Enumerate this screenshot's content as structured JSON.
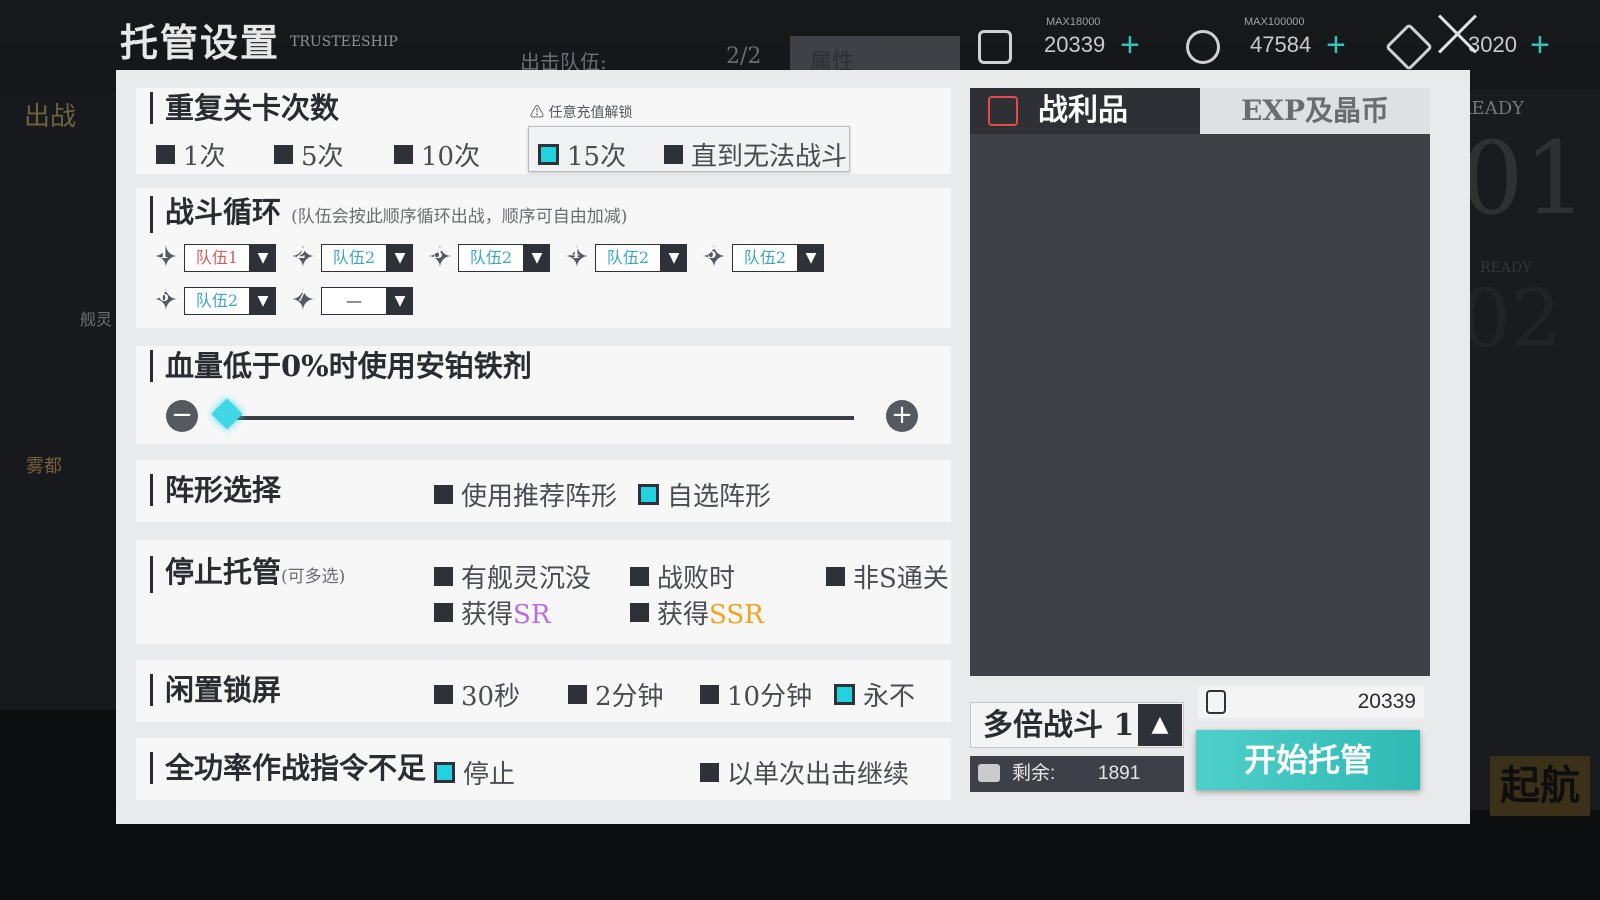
{
  "topbar": {
    "title": "托管设置",
    "subtitle": "TRUSTEESHIP",
    "fleet_label": "出击队伍:",
    "fleet_count": "2/2",
    "attribute_label": "属性",
    "resources": [
      {
        "icon": "oil-icon",
        "max": "MAX18000",
        "value": "20339"
      },
      {
        "icon": "coin-icon",
        "max": "MAX100000",
        "value": "47584"
      },
      {
        "icon": "gem-icon",
        "max": "",
        "value": "3020"
      }
    ]
  },
  "background": {
    "sortie": "出战",
    "ready1": "READY",
    "ready2": "READY",
    "fleet1": "01",
    "fleet2": "02",
    "sail": "起航",
    "city": "雾都",
    "ship": "舰灵"
  },
  "repeat": {
    "title": "重复关卡次数",
    "warn": "任意充值解锁",
    "options": [
      "1次",
      "5次",
      "10次",
      "15次",
      "直到无法战斗"
    ],
    "selected_index": 3
  },
  "cycle": {
    "title": "战斗循环",
    "note": "(队伍会按此顺序循环出战，顺序可自由加减)",
    "slots": [
      "队伍1",
      "队伍2",
      "队伍2",
      "队伍2",
      "队伍2",
      "队伍2",
      "—"
    ]
  },
  "hp": {
    "title": "血量低于0%时使用安铂铁剂",
    "value": 0
  },
  "formation": {
    "title": "阵形选择",
    "options": [
      "使用推荐阵形",
      "自选阵形"
    ],
    "selected_index": 1
  },
  "stop": {
    "title": "停止托管",
    "note": "(可多选)",
    "options": [
      "有舰灵沉没",
      "战败时",
      "非S通关",
      "获得",
      "获得"
    ],
    "sr_label": "SR",
    "ssr_label": "SSR"
  },
  "idle": {
    "title": "闲置锁屏",
    "options": [
      "30秒",
      "2分钟",
      "10分钟",
      "永不"
    ],
    "selected_index": 3
  },
  "orders": {
    "title": "全功率作战指令不足",
    "options": [
      "停止",
      "以单次出击继续"
    ],
    "selected_index": 0
  },
  "loot": {
    "tab_loot": "战利品",
    "tab_exp": "EXP及晶币"
  },
  "bottom": {
    "multi_label": "多倍战斗",
    "multi_value": "1",
    "remain_label": "剩余:",
    "remain_value": "1891",
    "oil_value": "20339",
    "start_label": "开始托管"
  },
  "colors": {
    "accent": "#22d3df",
    "start_button": "#2fb9b4",
    "sr": "#b86ee0",
    "ssr": "#f5a21b",
    "plus": "#31c4b8"
  }
}
